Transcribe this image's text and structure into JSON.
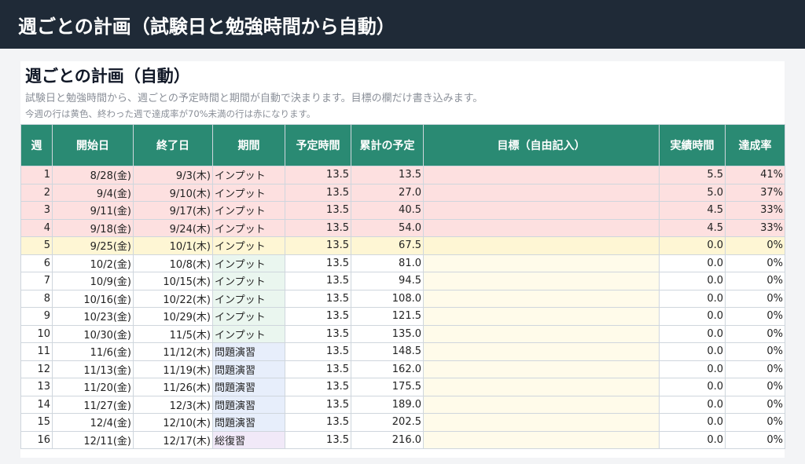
{
  "header": {
    "title": "週ごとの計画（試験日と勉強時間から自動）"
  },
  "panel": {
    "title": "週ごとの計画（自動）",
    "description": "試験日と勉強時間から、週ごとの予定時間と期間が自動で決まります。目標の欄だけ書き込みます。",
    "note": "今週の行は黄色、終わった週で達成率が70%未満の行は赤になります。"
  },
  "table": {
    "columns": [
      "週",
      "開始日",
      "終了日",
      "期間",
      "予定時間",
      "累計の予定",
      "目標（自由記入）",
      "実績時間",
      "達成率"
    ],
    "rows": [
      {
        "week": "1",
        "start": "8/28(金)",
        "end": "9/3(木)",
        "phase": "インプット",
        "phase_type": "input",
        "planned": "13.5",
        "cumulative": "13.5",
        "goal": "",
        "actual": "5.5",
        "rate": "41%",
        "state": "low"
      },
      {
        "week": "2",
        "start": "9/4(金)",
        "end": "9/10(木)",
        "phase": "インプット",
        "phase_type": "input",
        "planned": "13.5",
        "cumulative": "27.0",
        "goal": "",
        "actual": "5.0",
        "rate": "37%",
        "state": "low"
      },
      {
        "week": "3",
        "start": "9/11(金)",
        "end": "9/17(木)",
        "phase": "インプット",
        "phase_type": "input",
        "planned": "13.5",
        "cumulative": "40.5",
        "goal": "",
        "actual": "4.5",
        "rate": "33%",
        "state": "low"
      },
      {
        "week": "4",
        "start": "9/18(金)",
        "end": "9/24(木)",
        "phase": "インプット",
        "phase_type": "input",
        "planned": "13.5",
        "cumulative": "54.0",
        "goal": "",
        "actual": "4.5",
        "rate": "33%",
        "state": "low"
      },
      {
        "week": "5",
        "start": "9/25(金)",
        "end": "10/1(木)",
        "phase": "インプット",
        "phase_type": "input",
        "planned": "13.5",
        "cumulative": "67.5",
        "goal": "",
        "actual": "0.0",
        "rate": "0%",
        "state": "current"
      },
      {
        "week": "6",
        "start": "10/2(金)",
        "end": "10/8(木)",
        "phase": "インプット",
        "phase_type": "input",
        "planned": "13.5",
        "cumulative": "81.0",
        "goal": "",
        "actual": "0.0",
        "rate": "0%",
        "state": "normal"
      },
      {
        "week": "7",
        "start": "10/9(金)",
        "end": "10/15(木)",
        "phase": "インプット",
        "phase_type": "input",
        "planned": "13.5",
        "cumulative": "94.5",
        "goal": "",
        "actual": "0.0",
        "rate": "0%",
        "state": "normal"
      },
      {
        "week": "8",
        "start": "10/16(金)",
        "end": "10/22(木)",
        "phase": "インプット",
        "phase_type": "input",
        "planned": "13.5",
        "cumulative": "108.0",
        "goal": "",
        "actual": "0.0",
        "rate": "0%",
        "state": "normal"
      },
      {
        "week": "9",
        "start": "10/23(金)",
        "end": "10/29(木)",
        "phase": "インプット",
        "phase_type": "input",
        "planned": "13.5",
        "cumulative": "121.5",
        "goal": "",
        "actual": "0.0",
        "rate": "0%",
        "state": "normal"
      },
      {
        "week": "10",
        "start": "10/30(金)",
        "end": "11/5(木)",
        "phase": "インプット",
        "phase_type": "input",
        "planned": "13.5",
        "cumulative": "135.0",
        "goal": "",
        "actual": "0.0",
        "rate": "0%",
        "state": "normal"
      },
      {
        "week": "11",
        "start": "11/6(金)",
        "end": "11/12(木)",
        "phase": "問題演習",
        "phase_type": "practice",
        "planned": "13.5",
        "cumulative": "148.5",
        "goal": "",
        "actual": "0.0",
        "rate": "0%",
        "state": "normal"
      },
      {
        "week": "12",
        "start": "11/13(金)",
        "end": "11/19(木)",
        "phase": "問題演習",
        "phase_type": "practice",
        "planned": "13.5",
        "cumulative": "162.0",
        "goal": "",
        "actual": "0.0",
        "rate": "0%",
        "state": "normal"
      },
      {
        "week": "13",
        "start": "11/20(金)",
        "end": "11/26(木)",
        "phase": "問題演習",
        "phase_type": "practice",
        "planned": "13.5",
        "cumulative": "175.5",
        "goal": "",
        "actual": "0.0",
        "rate": "0%",
        "state": "normal"
      },
      {
        "week": "14",
        "start": "11/27(金)",
        "end": "12/3(木)",
        "phase": "問題演習",
        "phase_type": "practice",
        "planned": "13.5",
        "cumulative": "189.0",
        "goal": "",
        "actual": "0.0",
        "rate": "0%",
        "state": "normal"
      },
      {
        "week": "15",
        "start": "12/4(金)",
        "end": "12/10(木)",
        "phase": "問題演習",
        "phase_type": "practice",
        "planned": "13.5",
        "cumulative": "202.5",
        "goal": "",
        "actual": "0.0",
        "rate": "0%",
        "state": "normal"
      },
      {
        "week": "16",
        "start": "12/11(金)",
        "end": "12/17(木)",
        "phase": "総復習",
        "phase_type": "review",
        "planned": "13.5",
        "cumulative": "216.0",
        "goal": "",
        "actual": "0.0",
        "rate": "0%",
        "state": "normal"
      }
    ]
  },
  "colors": {
    "header_bg": "#1f2a37",
    "table_header_bg": "#2a8a73",
    "low_row": "#fde0e0",
    "current_row": "#fef6d4",
    "phase_input": "#eaf6ef",
    "phase_practice": "#e7eefb",
    "phase_review": "#f1e9f8",
    "goal_cell": "#fffbea"
  }
}
